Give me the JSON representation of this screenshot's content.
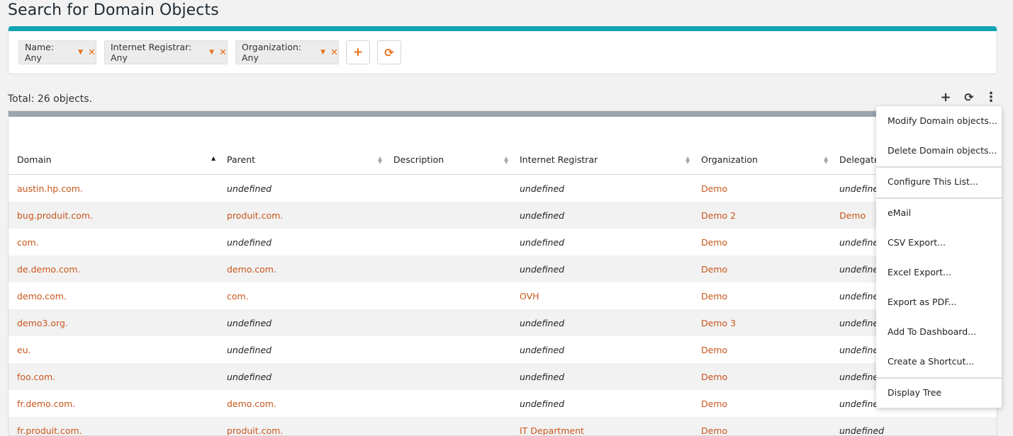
{
  "page": {
    "title": "Search for Domain Objects"
  },
  "criteria": {
    "chips": [
      {
        "label": "Name: Any"
      },
      {
        "label": "Internet Registrar: Any"
      },
      {
        "label": "Organization: Any"
      }
    ],
    "add_symbol": "+",
    "refresh_symbol": "⟳",
    "caret_symbol": "▼",
    "remove_symbol": "✕"
  },
  "results": {
    "total_text": "Total: 26 objects.",
    "toolbar": {
      "add_symbol": "+",
      "refresh_symbol": "⟳",
      "more_symbol": "⋮"
    },
    "columns": [
      "Domain",
      "Parent",
      "Description",
      "Internet Registrar",
      "Organization",
      "Delegate"
    ],
    "rows": [
      {
        "domain": "austin.hp.com.",
        "parent": "undefined",
        "description": "",
        "registrar": "undefined",
        "organization": "Demo",
        "delegate": "undefined"
      },
      {
        "domain": "bug.produit.com.",
        "parent": "produit.com.",
        "description": "",
        "registrar": "undefined",
        "organization": "Demo 2",
        "delegate": "Demo"
      },
      {
        "domain": "com.",
        "parent": "undefined",
        "description": "",
        "registrar": "undefined",
        "organization": "Demo",
        "delegate": "undefined"
      },
      {
        "domain": "de.demo.com.",
        "parent": "demo.com.",
        "description": "",
        "registrar": "undefined",
        "organization": "Demo",
        "delegate": "undefined"
      },
      {
        "domain": "demo.com.",
        "parent": "com.",
        "description": "",
        "registrar": "OVH",
        "organization": "Demo",
        "delegate": "undefined"
      },
      {
        "domain": "demo3.org.",
        "parent": "undefined",
        "description": "",
        "registrar": "undefined",
        "organization": "Demo 3",
        "delegate": "undefined"
      },
      {
        "domain": "eu.",
        "parent": "undefined",
        "description": "",
        "registrar": "undefined",
        "organization": "Demo",
        "delegate": "undefined"
      },
      {
        "domain": "foo.com.",
        "parent": "undefined",
        "description": "",
        "registrar": "undefined",
        "organization": "Demo",
        "delegate": "undefined"
      },
      {
        "domain": "fr.demo.com.",
        "parent": "demo.com.",
        "description": "",
        "registrar": "undefined",
        "organization": "Demo",
        "delegate": "undefined"
      },
      {
        "domain": "fr.produit.com.",
        "parent": "produit.com.",
        "description": "",
        "registrar": "IT Department",
        "organization": "Demo",
        "delegate": "undefined"
      }
    ]
  },
  "menu": {
    "items": [
      "Modify Domain objects...",
      "Delete Domain objects...",
      "Configure This List...",
      "eMail",
      "CSV Export...",
      "Excel Export...",
      "Export as PDF...",
      "Add To Dashboard...",
      "Create a Shortcut...",
      "Display Tree"
    ]
  },
  "colors": {
    "accent": "#e8701a",
    "link": "#c8561b",
    "criteria_bar": "#12a3b5",
    "results_bar": "#9aa5af"
  }
}
